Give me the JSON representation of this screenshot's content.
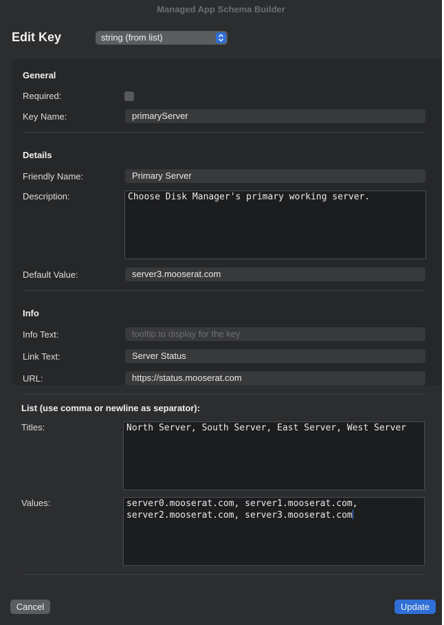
{
  "window": {
    "title": "Managed App Schema Builder"
  },
  "header": {
    "heading": "Edit Key",
    "type_select": "string (from list)"
  },
  "general": {
    "section_title": "General",
    "required_label": "Required:",
    "required_checked": false,
    "key_name_label": "Key Name:",
    "key_name_value": "primaryServer"
  },
  "details": {
    "section_title": "Details",
    "friendly_name_label": "Friendly Name:",
    "friendly_name_value": "Primary Server",
    "description_label": "Description:",
    "description_value": "Choose Disk Manager's primary working server.",
    "default_value_label": "Default Value:",
    "default_value_value": "server3.mooserat.com"
  },
  "info": {
    "section_title": "Info",
    "info_text_label": "Info Text:",
    "info_text_placeholder": "tooltip to display for the key",
    "link_text_label": "Link Text:",
    "link_text_value": "Server Status",
    "url_label": "URL:",
    "url_value": "https://status.mooserat.com"
  },
  "list": {
    "section_title": "List (use comma or newline as separator):",
    "titles_label": "Titles:",
    "titles_value": "North Server, South Server, East Server, West Server",
    "values_label": "Values:",
    "values_line1": "server0.mooserat.com, server1.mooserat.com,",
    "values_line2": "server2.mooserat.com, server3.mooserat.com"
  },
  "footer": {
    "cancel_label": "Cancel",
    "update_label": "Update"
  },
  "colors": {
    "accent": "#2f6fd6",
    "background": "#2b2d2f"
  }
}
